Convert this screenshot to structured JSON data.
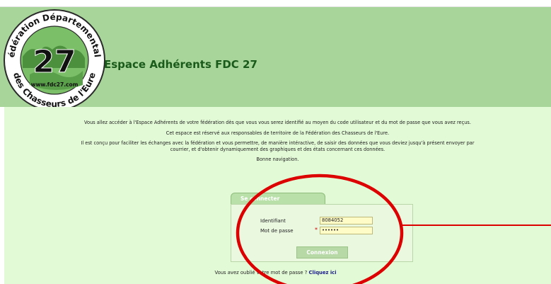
{
  "header": {
    "site_title": "Espace Adhérents FDC 27",
    "logo": {
      "top_text": "Fédération Départementale",
      "bottom_text": "des Chasseurs de l'Eure",
      "number": "27",
      "url": "www.fdc27.com"
    }
  },
  "intro": {
    "p1": "Vous allez accéder à l'Espace Adhérents de votre fédération dès que vous vous serez identifié au moyen du code utilisateur et du mot de passe que vous avez reçus.",
    "p2": "Cet espace est réservé aux responsables de territoire de la Fédération des Chasseurs de l'Eure.",
    "p3": "Il est conçu pour faciliter les échanges avec la fédération et vous permettre, de manière intéractive, de saisir des données que vous deviez jusqu'à présent envoyer par courrier, et d'obtenir dynamiquement des graphiques et des états concernant ces données.",
    "p4": "Bonne navigation."
  },
  "login": {
    "tab_label": "Se connecter",
    "identifiant_label": "Identifiant",
    "identifiant_value": "8084052",
    "password_label": "Mot de passe",
    "required_mark": "*",
    "password_value": "••••••",
    "submit_label": "Connexion"
  },
  "footer": {
    "forgot_text": "Vous avez oublié votre mot de passe ?",
    "forgot_link": "Cliquez ici"
  },
  "colors": {
    "banner": "#a8d69a",
    "content_bg": "#e2fad6",
    "annotation_red": "#dd0000"
  }
}
